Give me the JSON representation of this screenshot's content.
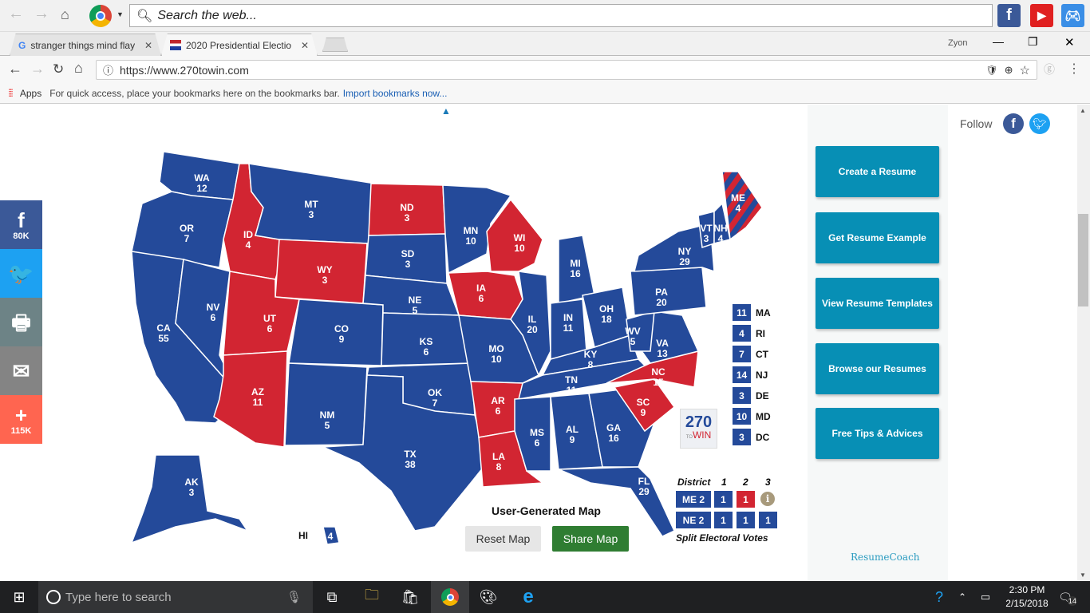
{
  "browser": {
    "search_placeholder": "Search the web...",
    "tabs": [
      {
        "label": "stranger things mind flay",
        "favicon": "google-g"
      },
      {
        "label": "2020 Presidential Electio",
        "favicon": "270towin"
      }
    ],
    "user_name": "Zyon",
    "url": "https://www.270towin.com",
    "bookmarks": {
      "apps_label": "Apps",
      "hint": "For quick access, place your bookmarks here on the bookmarks bar.",
      "import_link": "Import bookmarks now..."
    },
    "top_apps": [
      "facebook",
      "youtube",
      "games"
    ]
  },
  "social_share": [
    {
      "network": "facebook",
      "icon": "f",
      "count": "80K",
      "color": "#3b5998"
    },
    {
      "network": "twitter",
      "icon": "🐦",
      "count": "",
      "color": "#1da1f2"
    },
    {
      "network": "print",
      "icon": "🖶",
      "count": "",
      "color": "#6d8386"
    },
    {
      "network": "email",
      "icon": "✉",
      "count": "",
      "color": "#848484"
    },
    {
      "network": "more",
      "icon": "+",
      "count": "115K",
      "color": "#ff6550"
    }
  ],
  "map": {
    "colors": {
      "dem": "#244a9a",
      "rep": "#d22532"
    },
    "states": [
      {
        "abbr": "WA",
        "ev": "12",
        "party": "dem"
      },
      {
        "abbr": "OR",
        "ev": "7",
        "party": "dem"
      },
      {
        "abbr": "CA",
        "ev": "55",
        "party": "dem"
      },
      {
        "abbr": "ID",
        "ev": "4",
        "party": "rep"
      },
      {
        "abbr": "NV",
        "ev": "6",
        "party": "dem"
      },
      {
        "abbr": "MT",
        "ev": "3",
        "party": "dem"
      },
      {
        "abbr": "WY",
        "ev": "3",
        "party": "rep"
      },
      {
        "abbr": "UT",
        "ev": "6",
        "party": "rep"
      },
      {
        "abbr": "AZ",
        "ev": "11",
        "party": "rep"
      },
      {
        "abbr": "CO",
        "ev": "9",
        "party": "dem"
      },
      {
        "abbr": "NM",
        "ev": "5",
        "party": "dem"
      },
      {
        "abbr": "ND",
        "ev": "3",
        "party": "rep"
      },
      {
        "abbr": "SD",
        "ev": "3",
        "party": "dem"
      },
      {
        "abbr": "NE",
        "ev": "5",
        "party": "dem"
      },
      {
        "abbr": "KS",
        "ev": "6",
        "party": "dem"
      },
      {
        "abbr": "OK",
        "ev": "7",
        "party": "dem"
      },
      {
        "abbr": "TX",
        "ev": "38",
        "party": "dem"
      },
      {
        "abbr": "MN",
        "ev": "10",
        "party": "dem"
      },
      {
        "abbr": "IA",
        "ev": "6",
        "party": "rep"
      },
      {
        "abbr": "MO",
        "ev": "10",
        "party": "dem"
      },
      {
        "abbr": "AR",
        "ev": "6",
        "party": "rep"
      },
      {
        "abbr": "LA",
        "ev": "8",
        "party": "rep"
      },
      {
        "abbr": "WI",
        "ev": "10",
        "party": "rep"
      },
      {
        "abbr": "IL",
        "ev": "20",
        "party": "dem"
      },
      {
        "abbr": "MI",
        "ev": "16",
        "party": "dem"
      },
      {
        "abbr": "IN",
        "ev": "11",
        "party": "dem"
      },
      {
        "abbr": "OH",
        "ev": "18",
        "party": "dem"
      },
      {
        "abbr": "KY",
        "ev": "8",
        "party": "dem"
      },
      {
        "abbr": "TN",
        "ev": "11",
        "party": "dem"
      },
      {
        "abbr": "MS",
        "ev": "6",
        "party": "dem"
      },
      {
        "abbr": "AL",
        "ev": "9",
        "party": "dem"
      },
      {
        "abbr": "GA",
        "ev": "16",
        "party": "dem"
      },
      {
        "abbr": "FL",
        "ev": "29",
        "party": "dem"
      },
      {
        "abbr": "SC",
        "ev": "9",
        "party": "rep"
      },
      {
        "abbr": "NC",
        "ev": "15",
        "party": "rep"
      },
      {
        "abbr": "VA",
        "ev": "13",
        "party": "dem"
      },
      {
        "abbr": "WV",
        "ev": "5",
        "party": "dem"
      },
      {
        "abbr": "PA",
        "ev": "20",
        "party": "dem"
      },
      {
        "abbr": "NY",
        "ev": "29",
        "party": "dem"
      },
      {
        "abbr": "VT",
        "ev": "3",
        "party": "dem"
      },
      {
        "abbr": "NH",
        "ev": "4",
        "party": "dem"
      },
      {
        "abbr": "ME",
        "ev": "4",
        "party": "split"
      },
      {
        "abbr": "AK",
        "ev": "3",
        "party": "dem"
      },
      {
        "abbr": "HI",
        "ev": "4",
        "party": "dem"
      }
    ],
    "small_states": [
      {
        "ev": "11",
        "abbr": "MA"
      },
      {
        "ev": "4",
        "abbr": "RI"
      },
      {
        "ev": "7",
        "abbr": "CT"
      },
      {
        "ev": "14",
        "abbr": "NJ"
      },
      {
        "ev": "3",
        "abbr": "DE"
      },
      {
        "ev": "10",
        "abbr": "MD"
      },
      {
        "ev": "3",
        "abbr": "DC"
      }
    ],
    "logo": {
      "number": "270",
      "to": "TO",
      "win": "WIN"
    },
    "districts": {
      "header": [
        "District",
        "1",
        "2",
        "3"
      ],
      "rows": [
        {
          "label": "ME 2",
          "values": [
            {
              "v": "1",
              "party": "dem"
            },
            {
              "v": "1",
              "party": "rep"
            }
          ],
          "info": true
        },
        {
          "label": "NE 2",
          "values": [
            {
              "v": "1",
              "party": "dem"
            },
            {
              "v": "1",
              "party": "dem"
            },
            {
              "v": "1",
              "party": "dem"
            }
          ]
        }
      ],
      "caption": "Split Electoral Votes"
    },
    "title": "User-Generated Map",
    "reset_label": "Reset Map",
    "share_label": "Share Map"
  },
  "follow": {
    "label": "Follow"
  },
  "resume_ads": {
    "buttons": [
      "Create a Resume",
      "Get Resume Example",
      "View Resume Templates",
      "Browse our Resumes",
      "Free Tips & Advices"
    ],
    "brand": "ResumeCoach"
  },
  "taskbar": {
    "search_placeholder": "Type here to search",
    "time": "2:30 PM",
    "date": "2/15/2018",
    "notifications": "14"
  }
}
